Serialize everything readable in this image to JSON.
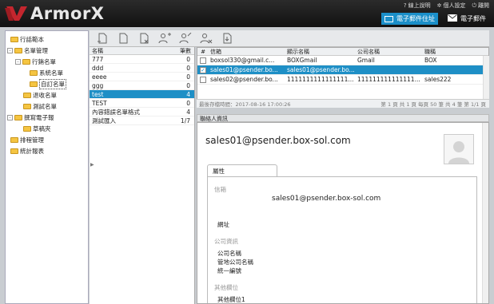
{
  "app": {
    "name": "ArmorX"
  },
  "top_links": [
    {
      "icon": "question-icon",
      "label": "線上說明"
    },
    {
      "icon": "gear-icon",
      "label": "個人設定"
    },
    {
      "icon": "power-icon",
      "label": "離開"
    }
  ],
  "top_tabs": [
    {
      "icon": "contacts-card-icon",
      "label": "電子郵件住址",
      "active": true
    },
    {
      "icon": "envelope-icon",
      "label": "電子郵件",
      "active": false
    }
  ],
  "sidebar": {
    "items": [
      {
        "label": "行話範本",
        "level": 0,
        "expander": ""
      },
      {
        "label": "名單管理",
        "level": 0,
        "expander": "-"
      },
      {
        "label": "行銷名單",
        "level": 1,
        "expander": "-"
      },
      {
        "label": "系統名單",
        "level": 2,
        "expander": ""
      },
      {
        "label": "自訂名單",
        "level": 2,
        "expander": "",
        "selected": true
      },
      {
        "label": "退收名單",
        "level": 1,
        "expander": ""
      },
      {
        "label": "測試名單",
        "level": 1,
        "expander": ""
      },
      {
        "label": "撰寫電子報",
        "level": 0,
        "expander": "-"
      },
      {
        "label": "草稿夾",
        "level": 1,
        "expander": ""
      },
      {
        "label": "排程管理",
        "level": 0,
        "expander": ""
      },
      {
        "label": "統計報表",
        "level": 0,
        "expander": ""
      }
    ]
  },
  "toolbar": {
    "buttons": [
      {
        "name": "new-list-button",
        "icon": "doc-plus-icon"
      },
      {
        "name": "edit-list-button",
        "icon": "doc-edit-icon"
      },
      {
        "name": "delete-list-button",
        "icon": "doc-x-icon"
      },
      {
        "name": "add-contact-button",
        "icon": "user-plus-icon"
      },
      {
        "name": "edit-contact-button",
        "icon": "user-edit-icon"
      },
      {
        "name": "remove-contact-button",
        "icon": "user-x-icon"
      },
      {
        "name": "import-button",
        "icon": "import-icon"
      }
    ]
  },
  "groups": {
    "headers": {
      "name": "名稱",
      "count": "筆數"
    },
    "rows": [
      {
        "name": "777",
        "count": "0"
      },
      {
        "name": "ddd",
        "count": "0"
      },
      {
        "name": "eeee",
        "count": "0"
      },
      {
        "name": "ggg",
        "count": "0"
      },
      {
        "name": "test",
        "count": "4",
        "selected": true
      },
      {
        "name": "TEST",
        "count": "0"
      },
      {
        "name": "內容錯誤名單格式",
        "count": "4"
      },
      {
        "name": "測試匯入",
        "count": "1/7"
      }
    ]
  },
  "contacts": {
    "headers": {
      "num": "#",
      "mail": "信箱",
      "display": "顯示名稱",
      "company": "公司名稱",
      "dept": "職稱"
    },
    "rows": [
      {
        "checked": false,
        "mail": "boxsol330@gmail.c...",
        "display": "BOXGmail",
        "company": "Gmail",
        "dept": "BOX"
      },
      {
        "checked": true,
        "mail": "sales01@psender.bo...",
        "display": "sales01@psender.bo...",
        "company": "",
        "dept": "",
        "selected": true
      },
      {
        "checked": false,
        "mail": "sales02@psender.bo...",
        "display": "1111111111111111...",
        "company": "111111111111111...",
        "dept": "sales222"
      }
    ],
    "footer_left": "最後存檔時間：2017-08-16 17:00:26",
    "footer_right": "第 1 頁 共 1 頁 每頁 50 筆 共 4 筆 第 1/1 頁"
  },
  "details": {
    "header": "聯絡人資訊",
    "title": "sales01@psender.box-sol.com",
    "tab": "屬性",
    "sections": {
      "mail_label": "信箱",
      "mail_value": "sales01@psender.box-sol.com",
      "website": "網址",
      "company_info": "公司資訊",
      "company_name": "公司名稱",
      "branch_name": "管地公司名稱",
      "tax_id": "統一編號",
      "other": "其他欄位",
      "other_field": "其他欄位1"
    }
  },
  "colors": {
    "accent": "#1e8fc6",
    "header": "#1a1a1a",
    "logo_red": "#c4262e"
  }
}
